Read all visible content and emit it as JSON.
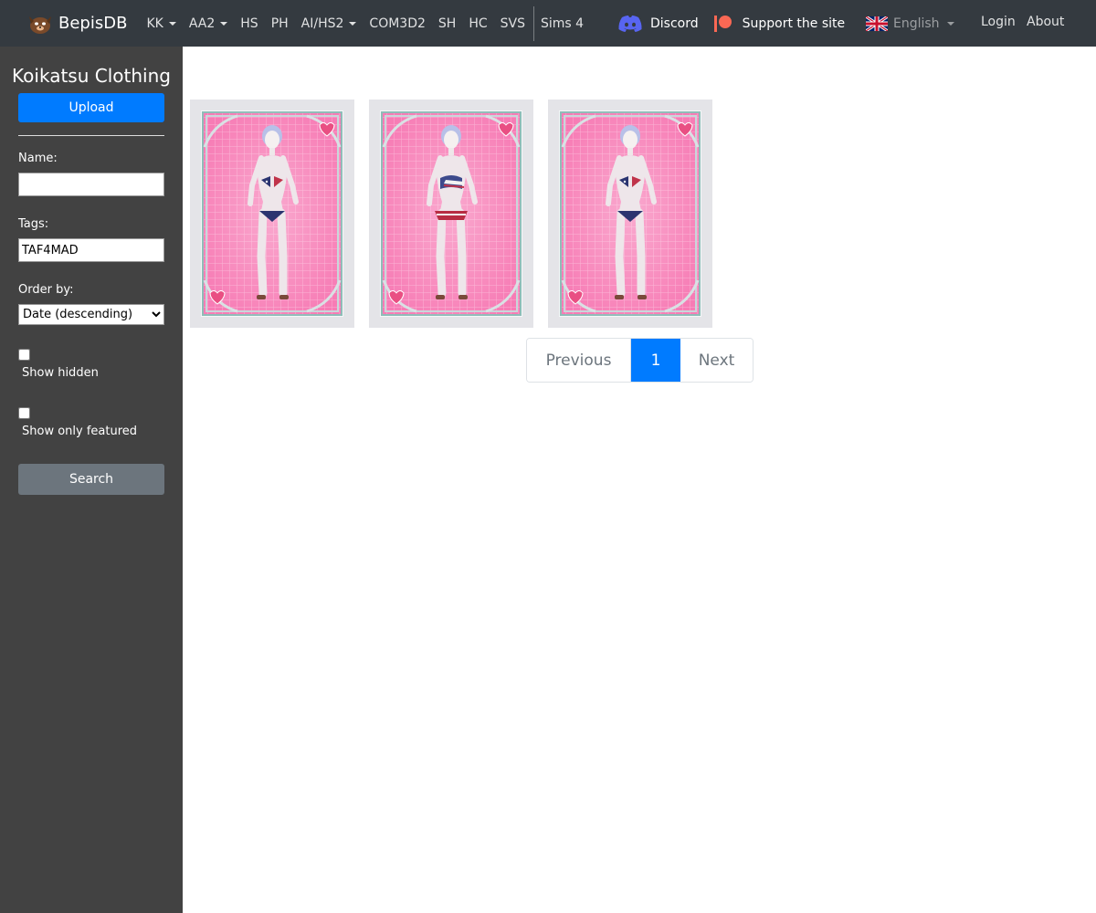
{
  "navbar": {
    "brand": "BepisDB",
    "links": [
      {
        "label": "KK",
        "dropdown": true
      },
      {
        "label": "AA2",
        "dropdown": true
      },
      {
        "label": "HS",
        "dropdown": false
      },
      {
        "label": "PH",
        "dropdown": false
      },
      {
        "label": "AI/HS2",
        "dropdown": true
      },
      {
        "label": "COM3D2",
        "dropdown": false
      },
      {
        "label": "SH",
        "dropdown": false
      },
      {
        "label": "HC",
        "dropdown": false
      },
      {
        "label": "SVS",
        "dropdown": false
      },
      {
        "label": "Sims 4",
        "dropdown": false
      }
    ],
    "discord_label": "Discord",
    "support_label": "Support the site",
    "language_label": "English",
    "login_label": "Login",
    "about_label": "About",
    "discord_color": "#5865f2",
    "patreon_color": "#f96854"
  },
  "sidebar": {
    "title": "Koikatsu Clothing",
    "upload_label": "Upload",
    "name_label": "Name:",
    "name_value": "",
    "tags_label": "Tags:",
    "tags_value": "TAF4MAD",
    "order_label": "Order by:",
    "order_value": "Date (descending)",
    "show_hidden_label": "Show hidden",
    "show_hidden_checked": false,
    "show_featured_label": "Show only featured",
    "show_featured_checked": false,
    "search_label": "Search"
  },
  "cards": [
    {
      "name": "clothing-card-1",
      "outfit": "bikini-stars"
    },
    {
      "name": "clothing-card-2",
      "outfit": "bikini-flag"
    },
    {
      "name": "clothing-card-3",
      "outfit": "bikini-stars"
    }
  ],
  "pagination": {
    "previous_label": "Previous",
    "current_page": "1",
    "next_label": "Next"
  },
  "colors": {
    "primary": "#007bff",
    "navbar_bg": "#343a40",
    "sidebar_bg": "#424242",
    "card_pink": "#f77cb5"
  }
}
